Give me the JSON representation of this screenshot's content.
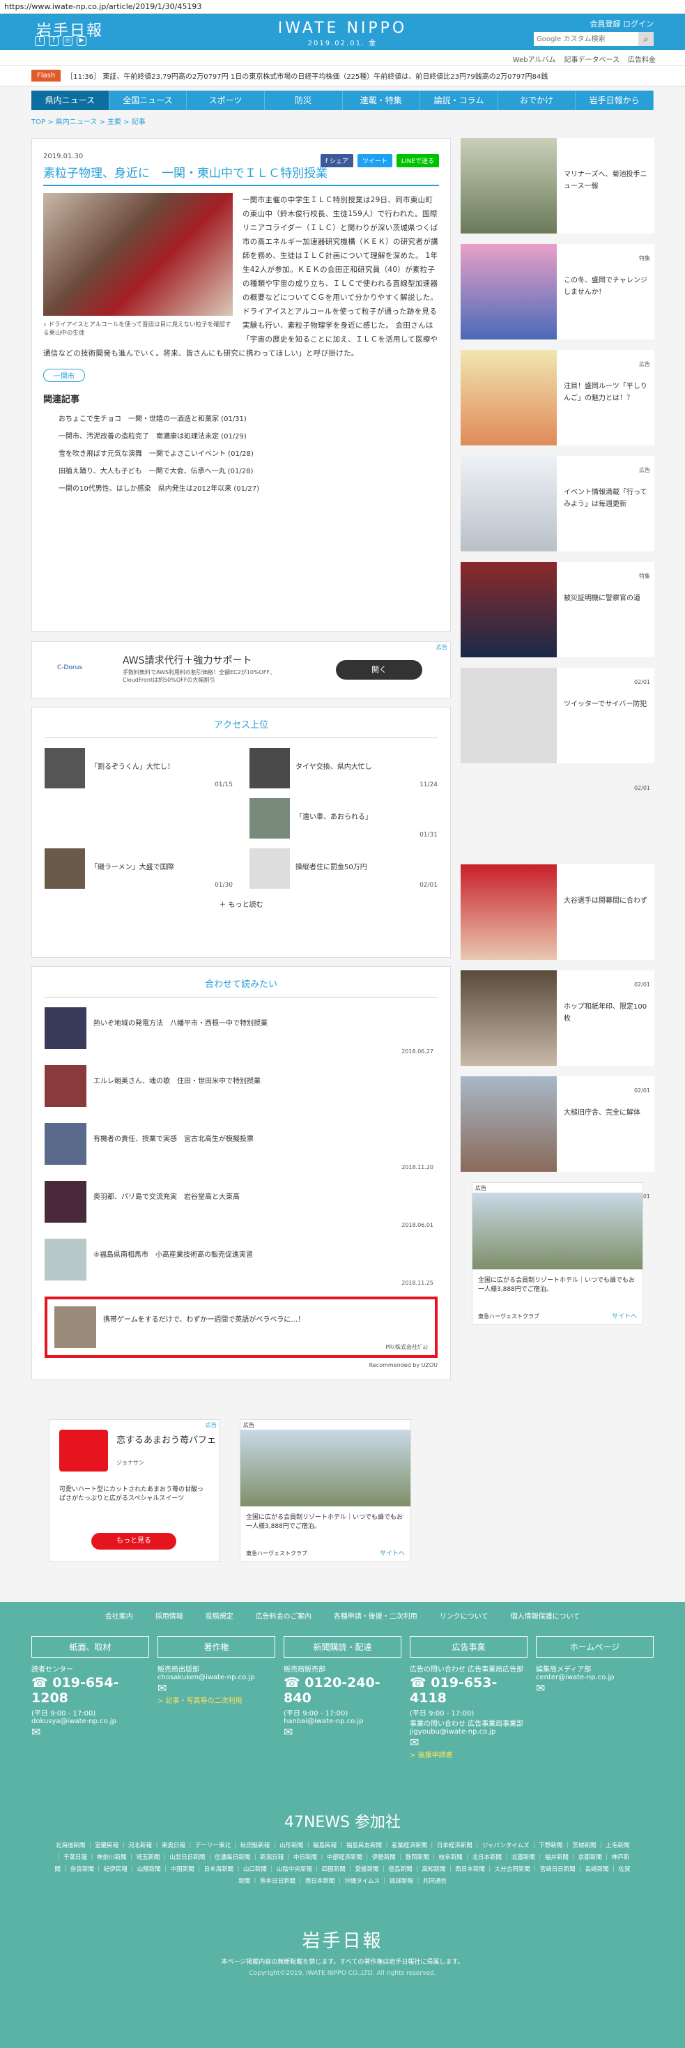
{
  "url": "https://www.iwate-np.co.jp/article/2019/1/30/45193",
  "header": {
    "logo": "岩手日報",
    "brand": "IWATE NIPPO",
    "date": "2019.02.01. 金",
    "links": "会員登録 ログイン",
    "search_placeholder": "Google カスタム検索"
  },
  "subnav": [
    "Webアルバム",
    "記事データベース",
    "広告料金"
  ],
  "flash": {
    "tag": "Flash",
    "text": "［11:36］ 東証、午前終値23,79円高の2万0797円 1日の東京株式市場の日経平均株価（225種）午前終値は、前日終値比23円79銭高の2万0797円84銭"
  },
  "gnav": [
    "県内ニュース",
    "全国ニュース",
    "スポーツ",
    "防災",
    "連載・特集",
    "論説・コラム",
    "おでかけ",
    "岩手日報から"
  ],
  "crumb": "TOP > 県内ニュース > 主要 > 記事",
  "article": {
    "share": [
      "f シェア",
      "ツイート",
      "LINEで送る"
    ],
    "date": "2019.01.30",
    "title": "素粒子物理、身近に　一関・東山中でＩＬＣ特別授業",
    "caption": "ドライアイスとアルコールを使って普段は目に見えない粒子を確認する東山中の生徒",
    "body": "一関市主催の中学生ＩＬＣ特別授業は29日、同市東山町の東山中（鈴木俊行校長、生徒159人）で行われた。国際リニアコライダー（ＩＬＣ）と関わりが深い茨城県つくば市の高エネルギー加速器研究機構（ＫＥＫ）の研究者が講師を務め、生徒はＩＬＣ計画について理解を深めた。 1年生42人が参加。ＫＥＫの会田正和研究員（40）が素粒子の種類や宇宙の成り立ち、ＩＬＣで使われる直線型加速器の概要などについてＣＧを用いて分かりやすく解説した。ドライアイスとアルコールを使って粒子が通った跡を見る実験も行い、素粒子物理学を身近に感じた。 会田さんは「宇宙の歴史を知ることに加え、ＩＬＣを活用して医療や通信などの技術開発も進んでいく。将来、皆さんにも研究に携わってほしい」と呼び掛けた。",
    "tag": "一関市",
    "related_title": "関連記事",
    "related": [
      "おちょこで生チョコ　一関・世嬉の一酒造と和菓家 (01/31)",
      "一関市、汚泥改善の造粒完了　南濃康は処理法未定 (01/29)",
      "雪を吹き飛ばす元気な演舞　一関でよさこいイベント (01/28)",
      "田植え踊り、大人も子ども　一関で大会、伝承へ一丸 (01/28)",
      "一関の10代男性、はしか感染　県内発生は2012年以来 (01/27)"
    ]
  },
  "ad1": {
    "label": "広告",
    "brand": "C-Dorus",
    "title": "AWS請求代行＋強力サポート",
    "text": "手数料無料でAWS利用料の割引価格！全額EC2が10%OFF、CloudFrontは約50%OFFの大幅割引",
    "button": "開く"
  },
  "access": {
    "title": "アクセス上位",
    "items": [
      {
        "t": "「割るぞうくん」大忙し！",
        "d": "01/15"
      },
      {
        "t": "タイヤ交換、県内大忙し",
        "d": "11/24"
      },
      {
        "t": "",
        "d": ""
      },
      {
        "t": "「遠い車、あおられる」",
        "d": "01/31"
      },
      {
        "t": "「磯ラーメン」大盛で国際",
        "d": "01/30"
      },
      {
        "t": "操縦者住に罰金50万円",
        "d": "02/01"
      }
    ],
    "more": "もっと読む"
  },
  "rec": {
    "title": "合わせて読みたい",
    "items": [
      {
        "t": "熱いぞ地域の発電方法　八幡平市・西根一中で特別授業",
        "d": "2018.06.27"
      },
      {
        "t": "エルレ朝美さん、魂の歌　住田・世田米中で特別授業",
        "d": ""
      },
      {
        "t": "有機者の責任、授業で実感　宮古北高生が模擬投票",
        "d": "2018.11.20"
      },
      {
        "t": "奥羽都、パリ島で交流充実　岩谷堂高と大東高",
        "d": "2018.06.01"
      },
      {
        "t": "④福島県南相馬市　小高産業技術高の販売促進実習",
        "d": "2018.11.25"
      }
    ],
    "pr": "携帯ゲームをするだけで、わずか一週間で英語がペラペラに…！",
    "pr_src": "PR(株式会社ｶﾞﾑ)",
    "credit": "Recommended by UZOU"
  },
  "ads2": [
    {
      "label": "広告",
      "brand": "ジョナサン",
      "title": "恋するあまおう苺パフェ",
      "text": "可愛いハート型にカットされたあまおう苺の甘酸っぱさがたっぷりと広がるスペシャルスイーツ",
      "button": "もっと見る"
    },
    {
      "label": "広告",
      "text": "全国に広がる会員制リゾートホテル｜いつでも誰でもお一人様3,888円でご宿泊。",
      "brand": "東急ハーヴェストクラブ",
      "site": "サイトへ"
    }
  ],
  "side": [
    {
      "t": "マリナーズへ、菊池投手ニュース一報",
      "d": "特集"
    },
    {
      "t": "この冬、盛岡でチャレンジしませんか！",
      "d": "広告"
    },
    {
      "t": "注目！盛岡ルーツ「平しりんご」の魅力とは！？",
      "d": "広告"
    },
    {
      "t": "イベント情報満載「行ってみよう」は毎週更新",
      "d": "特集"
    },
    {
      "t": "被災証明機に警察官の道",
      "d": "02/01"
    },
    {
      "t": "ツイッターでサイバー防犯",
      "d": "02/01"
    },
    {
      "t": "大谷選手は開幕間に合わず",
      "d": "02/01"
    },
    {
      "t": "ホップ和紙年印、限定100枚",
      "d": "02/01"
    },
    {
      "t": "大槌旧庁舎、完全に解体",
      "d": "02/01"
    }
  ],
  "side_ad": {
    "label": "広告",
    "text": "全国に広がる会員制リゾートホテル｜いつでも誰でもお一人様3,888円でご宿泊。",
    "brand": "東急ハーヴェストクラブ",
    "site": "サイトへ"
  },
  "footer": {
    "links": [
      "会社案内",
      "採用情報",
      "投稿規定",
      "広告料金のご案内",
      "各種申請・後援・二次利用",
      "リンクについて",
      "個人情報保護について"
    ],
    "cols": [
      {
        "h": "紙面、取材",
        "l1": "読者センター",
        "ph": "019-654-1208",
        "hrs": "(平日 9:00 - 17:00)",
        "mail": "dokusya@iwate-np.co.jp"
      },
      {
        "h": "著作権",
        "l1": "販売局出版部",
        "ph": "",
        "hrs": "",
        "mail": "chosakuken@iwate-np.co.jp",
        "extra": "> 記事・写真等の二次利用"
      },
      {
        "h": "新聞購読・配達",
        "l1": "販売局販売部",
        "ph": "0120-240-840",
        "hrs": "(平日 9:00 - 17:00)",
        "mail": "hanbai@iwate-np.co.jp"
      },
      {
        "h": "広告事業",
        "l1": "広告の問い合わせ 広告事業局広告部",
        "ph": "019-653-4118",
        "hrs": "(平日 9:00 - 17:00)",
        "mail": "事業の問い合わせ 広告事業局事業部 jigyoubu@iwate-np.co.jp",
        "extra": "> 後援申請書"
      },
      {
        "h": "ホームページ",
        "l1": "編集局メディア部",
        "ph": "",
        "hrs": "",
        "mail": "center@iwate-np.co.jp"
      }
    ],
    "n47": "47NEWS 参加社",
    "papers": "北海道新聞 ｜ 室蘭民報 ｜ 河北新報 ｜ 東奥日報 ｜ デーリー東北 ｜ 秋田魁新報 ｜ 山形新聞 ｜ 福島民報 ｜ 福島民友新聞 ｜ 産業経済新聞 ｜ 日本経済新聞 ｜ ジャパンタイムズ ｜ 下野新聞 ｜ 茨城新聞 ｜ 上毛新聞 ｜ 千葉日報 ｜ 神奈川新聞 ｜ 埼玉新聞 ｜ 山梨日日新聞 ｜ 信濃毎日新聞 ｜ 新潟日報 ｜ 中日新聞 ｜ 中部経済新聞 ｜ 伊勢新聞 ｜ 静岡新聞 ｜ 岐阜新聞 ｜ 北日本新聞 ｜ 北國新聞 ｜ 福井新聞 ｜ 京都新聞 ｜ 神戸新聞 ｜ 奈良新聞 ｜ 紀伊民報 ｜ 山陽新聞 ｜ 中国新聞 ｜ 日本海新聞 ｜ 山口新聞 ｜ 山陰中央新報 ｜ 四国新聞 ｜ 愛媛新聞 ｜ 徳島新聞 ｜ 高知新聞 ｜ 西日本新聞 ｜ 大分合同新聞 ｜ 宮崎日日新聞 ｜ 長崎新聞 ｜ 佐賀新聞 ｜ 熊本日日新聞 ｜ 南日本新聞 ｜ 沖縄タイムス ｜ 琉球新報 ｜ 共同通信",
    "logo": "岩手日報",
    "note": "本ページ掲載内容の無断転載を禁じます。すべての著作権は岩手日報社に帰属します。",
    "copy": "Copyright©2019, IWATE NIPPO CO.,LTD. All rights reserved."
  }
}
